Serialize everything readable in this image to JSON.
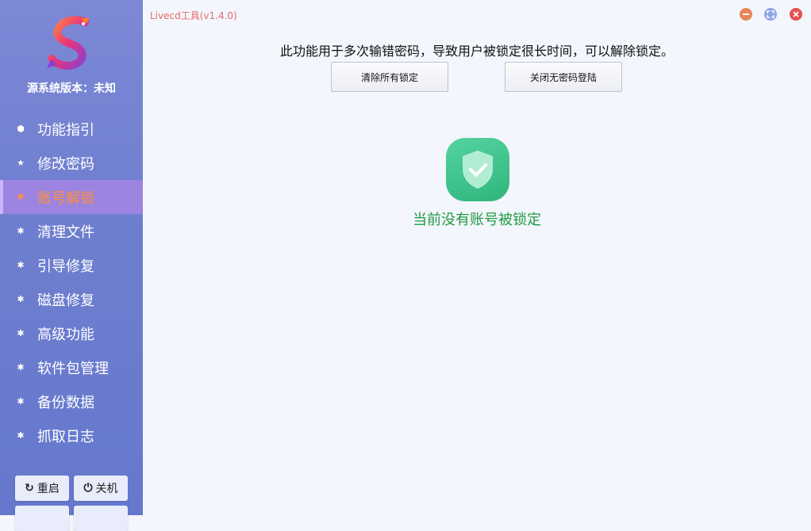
{
  "app": {
    "title": "Livecd工具(v1.4.0)"
  },
  "sidebar": {
    "version_text": "源系统版本：未知",
    "items": [
      {
        "label": "功能指引",
        "icon": "cube-icon",
        "active": false
      },
      {
        "label": "修改密码",
        "icon": "star-icon",
        "active": false
      },
      {
        "label": "账号解锁",
        "icon": "bug-icon",
        "active": true
      },
      {
        "label": "清理文件",
        "icon": "bug-icon",
        "active": false
      },
      {
        "label": "引导修复",
        "icon": "bug-icon",
        "active": false
      },
      {
        "label": "磁盘修复",
        "icon": "bug-icon",
        "active": false
      },
      {
        "label": "高级功能",
        "icon": "bug-icon",
        "active": false
      },
      {
        "label": "软件包管理",
        "icon": "bug-icon",
        "active": false
      },
      {
        "label": "备份数据",
        "icon": "bug-icon",
        "active": false
      },
      {
        "label": "抓取日志",
        "icon": "bug-icon",
        "active": false
      }
    ],
    "buttons": {
      "restart": "重启",
      "shutdown": "关机"
    }
  },
  "main": {
    "description": "此功能用于多次输错密码，导致用户被锁定很长时间，可以解除锁定。",
    "clear_locks_button": "清除所有锁定",
    "disable_passwordless_button": "关闭无密码登陆",
    "status_text": "当前没有账号被锁定"
  },
  "colors": {
    "sidebar": "#6f7fcf",
    "active_item_bg": "#9d84e0",
    "active_item_text": "#ff8f3a",
    "status_green": "#1f9a42",
    "title_red": "#e66a6a"
  }
}
